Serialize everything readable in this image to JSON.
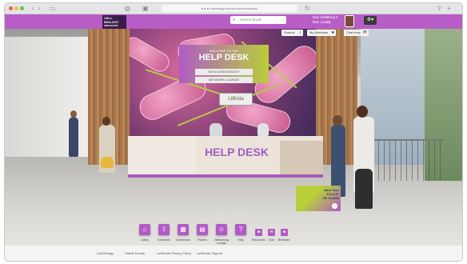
{
  "browser": {
    "url": "● ● ● mybiology.com/products/helpdesk"
  },
  "header": {
    "logo_text": [
      "CELL",
      "BIOLOGY",
      "INNOVATOR"
    ],
    "search_placeholder": "Search Booth",
    "user_line1": "Dan Goldberg ▾",
    "user_line2": "Dan Loudly"
  },
  "top_actions": {
    "sound_label": "Sounds",
    "briefcase_label": "My Briefcase",
    "chat_label": "Chat Help"
  },
  "helpdesk": {
    "subtitle": "WELCOME TO THE",
    "title": "HELP DESK",
    "button1": "NEED ASSISTANCE?",
    "button2": "NETWORK LOUNGE",
    "brand": "LIBrota",
    "desk_text": "HELP DESK"
  },
  "promo": {
    "line1": "Earn Your P.A.C.E.",
    "line2": "CE Credits"
  },
  "dock": {
    "items": [
      {
        "label": "Lobby",
        "icon": "⌂"
      },
      {
        "label": "Exhibitors",
        "icon": "⇧"
      },
      {
        "label": "Conference",
        "icon": "▦"
      },
      {
        "label": "Posters",
        "icon": "▤"
      },
      {
        "label": "Networking Lounge",
        "icon": "☺"
      },
      {
        "label": "Help",
        "icon": "?"
      }
    ],
    "secondary": [
      {
        "label": "Resources",
        "icon": "■"
      },
      {
        "label": "Chat",
        "icon": "✉"
      },
      {
        "label": "Briefcase",
        "icon": "■"
      }
    ]
  },
  "footer": {
    "links": [
      "Cell Biology",
      "Visible Events",
      "LabRoots Privacy Policy",
      "LabRoots Support"
    ]
  }
}
